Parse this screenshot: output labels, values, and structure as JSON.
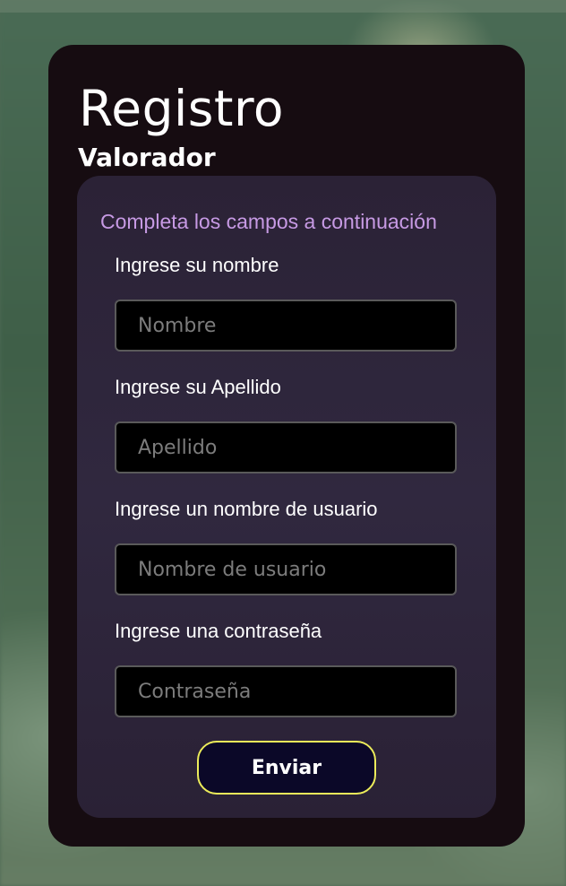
{
  "page": {
    "title": "Registro",
    "subtitle": "Valorador"
  },
  "form": {
    "instructions": "Completa los campos a continuación",
    "fields": [
      {
        "label": "Ingrese su nombre",
        "placeholder": "Nombre",
        "value": ""
      },
      {
        "label": "Ingrese su Apellido",
        "placeholder": "Apellido",
        "value": ""
      },
      {
        "label": "Ingrese un nombre de usuario",
        "placeholder": "Nombre de usuario",
        "value": ""
      },
      {
        "label": "Ingrese una contraseña",
        "placeholder": "Contraseña",
        "value": ""
      }
    ],
    "submit_label": "Enviar"
  },
  "colors": {
    "card_background": "#160c11",
    "panel_background": "#2e2639",
    "instructions_text": "#c79ae4",
    "input_background": "#000000",
    "input_border": "#5a5a5a",
    "button_background": "#0b0828",
    "button_border": "#ecec5a"
  }
}
